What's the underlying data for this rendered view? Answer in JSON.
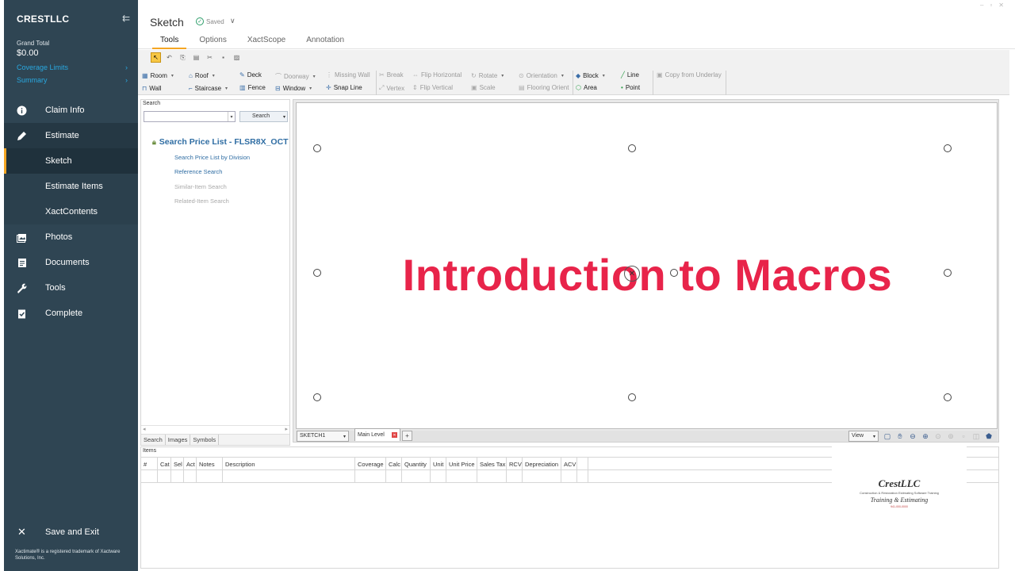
{
  "sidebar": {
    "brand": "CRESTLLC",
    "grand_total_label": "Grand Total",
    "grand_total_value": "$0.00",
    "links": [
      {
        "label": "Coverage Limits"
      },
      {
        "label": "Summary"
      }
    ],
    "nav": [
      {
        "label": "Claim Info",
        "icon": "info-icon"
      },
      {
        "label": "Estimate",
        "icon": "pencil-icon"
      },
      {
        "label": "Sketch",
        "sub": true,
        "active": true
      },
      {
        "label": "Estimate Items",
        "sub": true
      },
      {
        "label": "XactContents",
        "sub": true
      },
      {
        "label": "Photos",
        "icon": "photos-icon"
      },
      {
        "label": "Documents",
        "icon": "documents-icon"
      },
      {
        "label": "Tools",
        "icon": "wrench-icon"
      },
      {
        "label": "Complete",
        "icon": "clipboard-check-icon"
      }
    ],
    "save_exit": "Save and Exit",
    "legal": "Xactimate® is a registered trademark of Xactware Solutions, Inc."
  },
  "header": {
    "title": "Sketch",
    "saved": "Saved",
    "tabs": [
      "Tools",
      "Options",
      "XactScope",
      "Annotation"
    ],
    "active_tab": "Tools"
  },
  "ribbon": {
    "room": "Room",
    "roof": "Roof",
    "deck": "Deck",
    "doorway": "Doorway",
    "missing_wall": "Missing Wall",
    "wall": "Wall",
    "staircase": "Staircase",
    "fence": "Fence",
    "window": "Window",
    "snap_line": "Snap Line",
    "break": "Break",
    "flip_horizontal": "Flip Horizontal",
    "rotate": "Rotate",
    "orientation": "Orientation",
    "vertex": "Vertex",
    "flip_vertical": "Flip Vertical",
    "scale": "Scale",
    "flooring_orient": "Flooring Orient",
    "block": "Block",
    "line": "Line",
    "area": "Area",
    "point": "Point",
    "copy_from_underlay": "Copy from Underlay"
  },
  "search_panel": {
    "label": "Search",
    "button": "Search",
    "title": "Search Price List - FLSR8X_OCT",
    "links": [
      "Search Price List by Division",
      "Reference Search"
    ],
    "disabled_links": [
      "Similar-Item Search",
      "Related-Item Search"
    ],
    "tabs": [
      "Search",
      "Images",
      "Symbols"
    ]
  },
  "canvas": {
    "slide_title": "Introduction to Macros",
    "sketch_select": "SKETCH1",
    "level_tab": "Main Level",
    "view_select": "View"
  },
  "items": {
    "label": "Items",
    "columns": [
      "#",
      "Cat",
      "Sel",
      "Act",
      "Notes",
      "Description",
      "Coverage",
      "Calc",
      "Quantity",
      "Unit",
      "Unit Price",
      "Sales Tax",
      "RCV",
      "Depreciation",
      "ACV"
    ]
  },
  "logo": {
    "name": "CrestLLC",
    "line": "Construction & Restoration Estimating Software Training",
    "sub": "Training & Estimating",
    "small": "941-000-0000"
  },
  "colors": {
    "sidebar_bg": "#2f4553",
    "accent": "#f5a623",
    "link": "#29a8e0",
    "title_red": "#e8244a"
  }
}
